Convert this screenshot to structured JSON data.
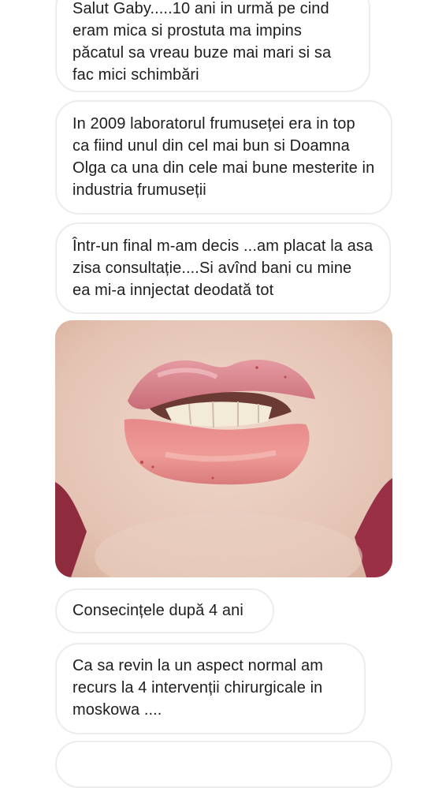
{
  "messages": [
    {
      "text": "Salut Gaby.....10 ani in urmă pe cind eram mica si prostuta ma impins păcatul sa vreau buze mai mari si sa fac mici schimbări"
    },
    {
      "text": "In 2009 laboratorul frumuseței era in top ca fiind unul din cel mai bun si Doamna Olga ca una din cele mai bune mesterite in industria frumuseții"
    },
    {
      "text": "Într-un final m-am decis ...am placat la asa zisa consultație....Si avînd bani cu mine ea mi-a innjectat deodată tot"
    },
    {
      "text": "Consecințele după 4 ani"
    },
    {
      "text": "Ca sa revin la un aspect normal am recurs la 4 intervenții chirurgicale in moskowa ...."
    },
    {
      "text": ""
    }
  ],
  "photo": {
    "subject": "lips"
  }
}
